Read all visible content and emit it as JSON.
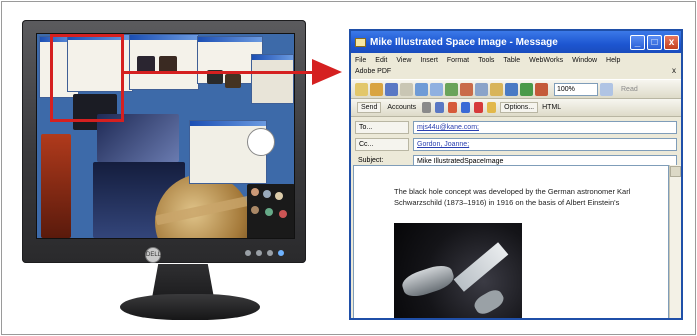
{
  "mail": {
    "title": "Mike Illustrated Space Image - Message",
    "window_buttons": [
      "_",
      "□",
      "x"
    ],
    "menu_row1": [
      "File",
      "Edit",
      "View",
      "Insert",
      "Format",
      "Tools",
      "Table",
      "WebWorks",
      "Window",
      "Help"
    ],
    "menu_row2": [
      "Adobe PDF"
    ],
    "menu_close": "x",
    "zoom": "100%",
    "read_label": "Read",
    "toolbar2": {
      "send": "Send",
      "accounts": "Accounts",
      "options": "Options...",
      "format": "HTML"
    },
    "fields": {
      "to_label": "To...",
      "to_value": "mjs44u@kane.com;",
      "cc_label": "Cc...",
      "cc_value": "Gordon, Joanne;",
      "subject_label": "Subject:",
      "subject_value": "Mike IllustratedSpaceImage"
    },
    "body_text": "The black hole concept was developed by the German astronomer Karl Schwarzschild (1873–1916) in 1916 on the basis of Albert Einstein's"
  },
  "colors": {
    "highlight": "#d52020",
    "titlebar": "#1d56d1",
    "link": "#2a3fb0"
  },
  "monitor": {
    "logo": "DELL"
  }
}
